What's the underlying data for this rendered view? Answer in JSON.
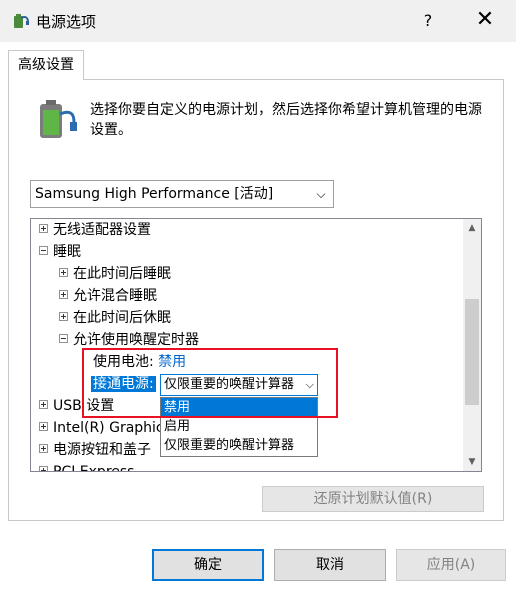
{
  "window": {
    "title": "电源选项",
    "help": "?",
    "close": "✕"
  },
  "tabs": [
    {
      "label": "高级设置"
    }
  ],
  "description": "选择你要自定义的电源计划，然后选择你希望计算机管理的电源设置。",
  "plan_select": {
    "value": "Samsung High Performance [活动]",
    "chevron": "⌵"
  },
  "tree": {
    "items": [
      {
        "label": "无线适配器设置"
      },
      {
        "label": "睡眠"
      },
      {
        "label": "在此时间后睡眠"
      },
      {
        "label": "允许混合睡眠"
      },
      {
        "label": "在此时间后休眠"
      },
      {
        "label": "允许使用唤醒定时器"
      },
      {
        "label": "使用电池:",
        "value": "禁用"
      },
      {
        "label": "接通电源:",
        "value": "仅限重要的唤醒计算器"
      },
      {
        "label": "USB 设置"
      },
      {
        "label": "Intel(R) Graphics Settings"
      },
      {
        "label": "电源按钮和盖子"
      },
      {
        "label": "PCI Express"
      }
    ],
    "scroll_up": "▲",
    "scroll_down": "▼"
  },
  "dropdown_options": [
    {
      "label": "禁用",
      "selected": true
    },
    {
      "label": "启用",
      "selected": false
    },
    {
      "label": "仅限重要的唤醒计算器",
      "selected": false
    }
  ],
  "buttons": {
    "restore": "还原计划默认值(R)",
    "ok": "确定",
    "cancel": "取消",
    "apply": "应用(A)"
  },
  "colors": {
    "accent": "#0078d7",
    "highlight_box": "#e81123",
    "link": "#0066cc"
  }
}
